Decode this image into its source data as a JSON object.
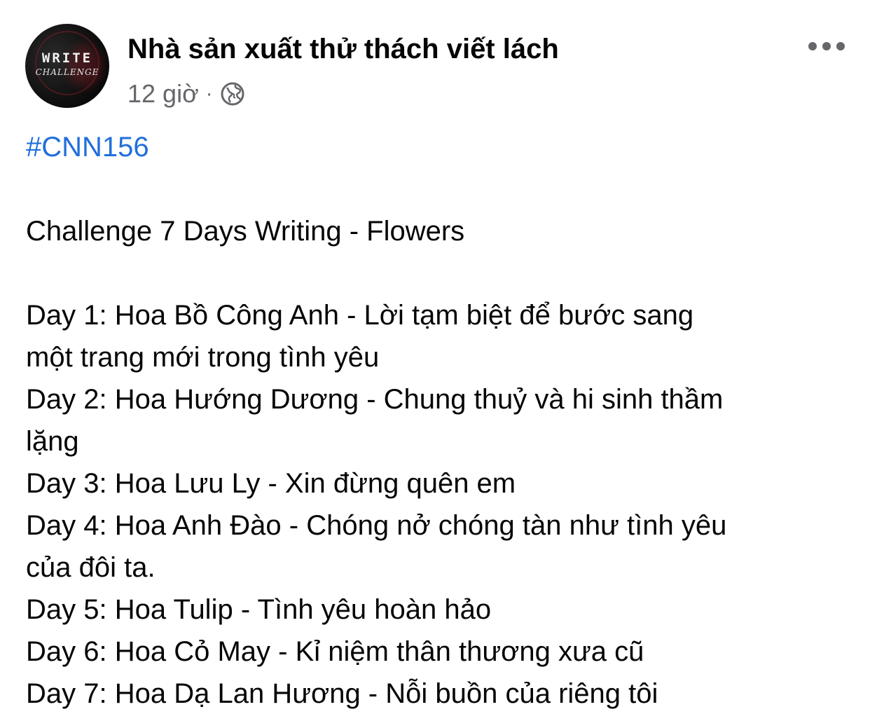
{
  "post": {
    "author": "Nhà sản xuất thử thách viết lách",
    "avatar_text_line1": "WRITE",
    "avatar_text_line2": "CHALLENGE",
    "time": "12 giờ",
    "separator": "·",
    "privacy_icon": "globe-icon",
    "more_icon": "more-options-icon",
    "hashtag": "#CNN156",
    "title": "Challenge 7 Days Writing - Flowers",
    "lines": [
      "Day 1: Hoa Bồ Công Anh - Lời tạm biệt để bước sang",
      "một trang mới trong tình yêu",
      "Day 2: Hoa Hướng Dương - Chung thuỷ và hi sinh thầm",
      "lặng",
      "Day 3: Hoa Lưu Ly - Xin đừng quên em",
      "Day 4: Hoa Anh Đào - Chóng nở chóng tàn như tình yêu",
      "của đôi ta.",
      "Day 5: Hoa Tulip - Tình yêu hoàn hảo",
      "Day 6: Hoa Cỏ May - Kỉ niệm thân thương xưa cũ",
      "Day 7: Hoa Dạ Lan Hương - Nỗi buồn của riêng tôi"
    ]
  },
  "colors": {
    "text": "#050505",
    "secondary_text": "#65676b",
    "link": "#216fdb",
    "background": "#ffffff"
  }
}
